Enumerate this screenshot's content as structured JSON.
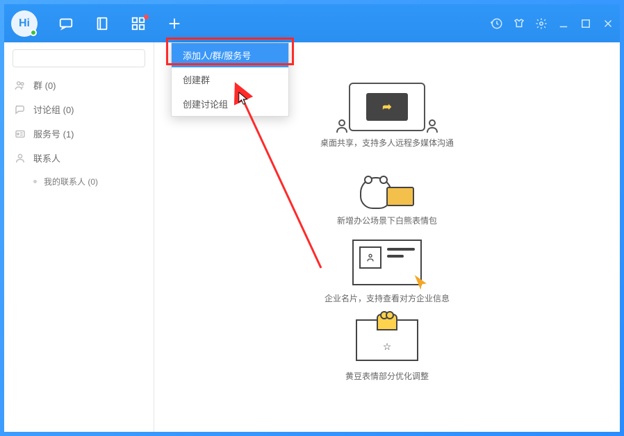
{
  "app": {
    "logo_text": "Hi"
  },
  "titlebar_icons": [
    "message-icon",
    "book-icon",
    "apps-icon",
    "plus-icon"
  ],
  "window_icons": [
    "history-icon",
    "shirt-icon",
    "settings-icon",
    "minimize-icon",
    "maximize-icon",
    "close-icon"
  ],
  "sidebar": {
    "search_placeholder": "",
    "items": [
      {
        "icon": "group-icon",
        "label": "群 (0)"
      },
      {
        "icon": "discuss-icon",
        "label": "讨论组 (0)"
      },
      {
        "icon": "service-icon",
        "label": "服务号 (1)"
      },
      {
        "icon": "contacts-icon",
        "label": "联系人"
      }
    ],
    "sub": {
      "label": "我的联系人 (0)"
    }
  },
  "dropdown": {
    "items": [
      {
        "label": "添加人/群/服务号",
        "selected": true
      },
      {
        "label": "创建群",
        "selected": false
      },
      {
        "label": "创建讨论组",
        "selected": false
      }
    ]
  },
  "features": [
    {
      "label": "桌面共享，支持多人远程多媒体沟通"
    },
    {
      "label": "新增办公场景下白熊表情包"
    },
    {
      "label": "企业名片，支持查看对方企业信息"
    },
    {
      "label": "黄豆表情部分优化调整"
    }
  ]
}
